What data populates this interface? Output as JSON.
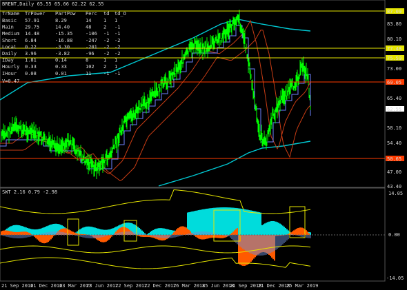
{
  "header": {
    "title": "BRENT,Daily  65.55 65.66 62.22 62.55"
  },
  "trend_table": {
    "columns": [
      "TrName",
      "TrPower",
      "PartPow",
      "Perc",
      "td",
      "td_O"
    ],
    "rows": [
      [
        "Basic",
        "57.91",
        "8.29",
        "14",
        "1",
        "1"
      ],
      [
        "Main",
        "29.75",
        "14.40",
        "48",
        "2",
        "-1"
      ],
      [
        "Medium",
        "14.48",
        "-15.35",
        "-106",
        "-1",
        "-1"
      ],
      [
        "Short",
        "6.84",
        "-16.88",
        "-247",
        "-2",
        "-2"
      ],
      [
        "Local",
        "0.22",
        "-3.30",
        "-201",
        "-2",
        "-2"
      ],
      [
        "Daily",
        "3.96",
        "-3.82",
        "-96",
        "-2",
        "-2"
      ],
      [
        "IDay",
        "1.81",
        "0.14",
        "8",
        "1",
        "1"
      ],
      [
        "Hourly",
        "0.33",
        "0.33",
        "102",
        "2",
        "1"
      ],
      [
        "IHour",
        "0.08",
        "0.01",
        "11",
        "-1",
        "-1"
      ]
    ],
    "footer": "V=0.47"
  },
  "price_labels": [
    {
      "text": "87.09",
      "kind": "level"
    },
    {
      "text": "83.80",
      "kind": "tick"
    },
    {
      "text": "80.10",
      "kind": "tick"
    },
    {
      "text": "77.48",
      "kind": "level"
    },
    {
      "text": "75.59",
      "kind": "level"
    },
    {
      "text": "73.00",
      "kind": "tick"
    },
    {
      "text": "69.05",
      "kind": "level"
    },
    {
      "text": "65.40",
      "kind": "tick"
    },
    {
      "text": "62.55",
      "kind": "current"
    },
    {
      "text": "58.10",
      "kind": "tick"
    },
    {
      "text": "54.40",
      "kind": "tick"
    },
    {
      "text": "50.65",
      "kind": "level"
    },
    {
      "text": "47.00",
      "kind": "tick"
    },
    {
      "text": "43.40",
      "kind": "tick"
    }
  ],
  "indicator": {
    "title": "SWT 2.16 0.79 -2.98",
    "axis_labels": [
      "14.05",
      "0.00",
      "-14.05"
    ]
  },
  "date_labels": [
    "21 Sep 2016",
    "21 Dec 2016",
    "23 Mar 2017",
    "23 Jun 2017",
    "22 Sep 2017",
    "22 Dec 2017",
    "26 Mar 2018",
    "25 Jun 2018",
    "21 Sep 2018",
    "21 Dec 2018",
    "25 Mar 2019"
  ],
  "colors": {
    "background": "#000000",
    "price": "#00ff00",
    "level_yellow": "#e6e600",
    "level_red": "#ff3c00",
    "envelope_cyan": "#00c8d2",
    "step_blue": "#6e82ff",
    "ma_red": "#c83c14",
    "hist_cyan": "#00dcdc",
    "hist_orange": "#ff5a00",
    "hist_blue": "#6e8cd2"
  }
}
